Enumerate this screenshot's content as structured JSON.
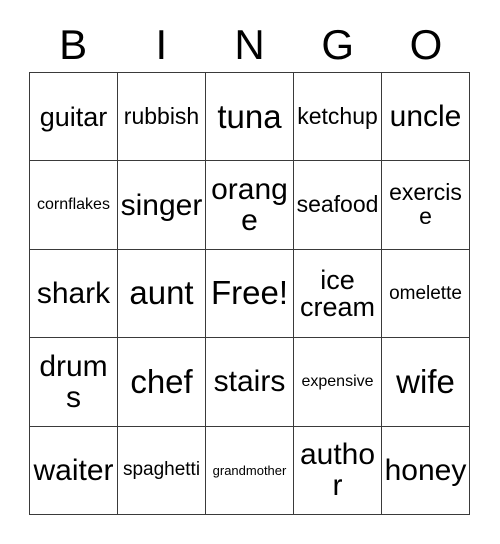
{
  "card": {
    "header_letters": [
      "B",
      "I",
      "N",
      "G",
      "O"
    ],
    "free_space_label": "Free!",
    "rows": [
      [
        {
          "label": "guitar",
          "size": "lg"
        },
        {
          "label": "rubbish",
          "size": "md"
        },
        {
          "label": "tuna",
          "size": "xxl"
        },
        {
          "label": "ketchup",
          "size": "md"
        },
        {
          "label": "uncle",
          "size": "xl"
        }
      ],
      [
        {
          "label": "cornflakes",
          "size": "xs"
        },
        {
          "label": "singer",
          "size": "xl"
        },
        {
          "label": "orange",
          "size": "xl"
        },
        {
          "label": "seafood",
          "size": "md"
        },
        {
          "label": "exercise",
          "size": "md"
        }
      ],
      [
        {
          "label": "shark",
          "size": "xl"
        },
        {
          "label": "aunt",
          "size": "xxl"
        },
        {
          "label": "Free!",
          "size": "xxl"
        },
        {
          "label": "ice cream",
          "size": "lg"
        },
        {
          "label": "omelette",
          "size": "sm"
        }
      ],
      [
        {
          "label": "drums",
          "size": "xl"
        },
        {
          "label": "chef",
          "size": "xxl"
        },
        {
          "label": "stairs",
          "size": "xl"
        },
        {
          "label": "expensive",
          "size": "xs"
        },
        {
          "label": "wife",
          "size": "xxl"
        }
      ],
      [
        {
          "label": "waiter",
          "size": "xl"
        },
        {
          "label": "spaghetti",
          "size": "sm"
        },
        {
          "label": "grandmother",
          "size": "xxs"
        },
        {
          "label": "author",
          "size": "xl"
        },
        {
          "label": "honey",
          "size": "xl"
        }
      ]
    ]
  },
  "colors": {
    "background": "#ffffff",
    "text": "#000000",
    "border": "#3a3a3a"
  }
}
